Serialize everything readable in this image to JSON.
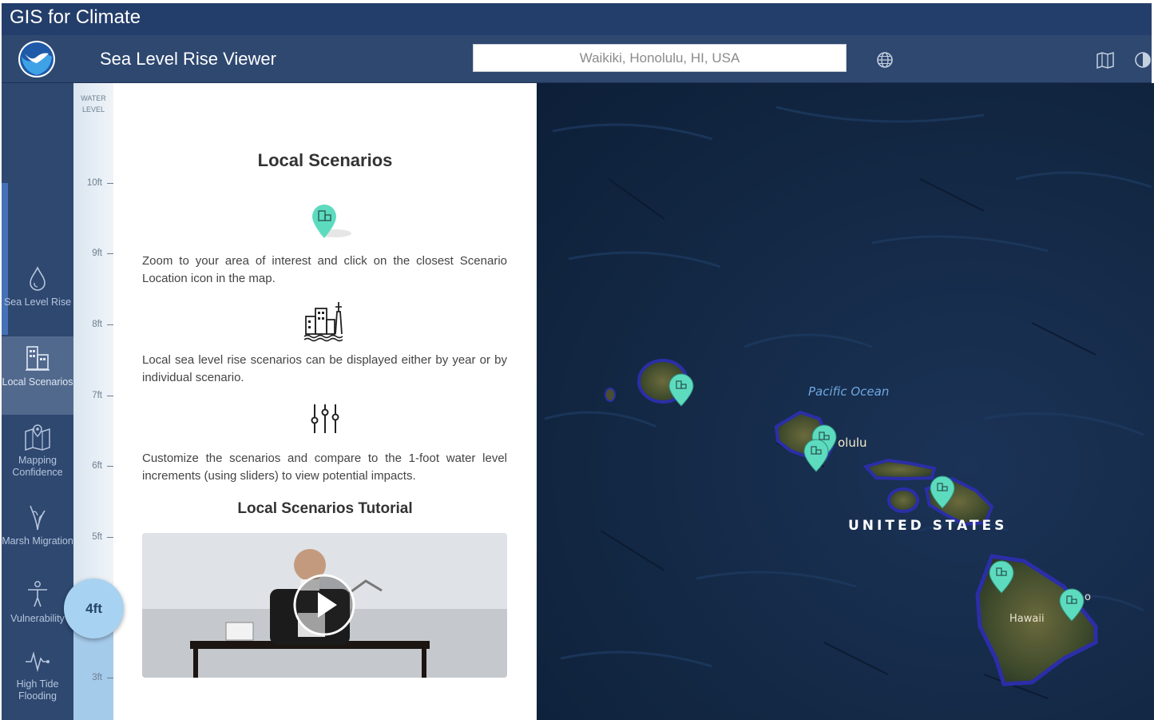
{
  "app": {
    "title": "GIS for Climate"
  },
  "toolbar": {
    "viewer_title": "Sea Level Rise Viewer",
    "search_value": "Waikiki, Honolulu, HI, USA",
    "icons": [
      "noaa-logo",
      "globe-icon",
      "basemap-icon",
      "contrast-icon"
    ]
  },
  "sidebar": {
    "items": [
      {
        "label": "Sea Level Rise",
        "icon": "water-drop-icon"
      },
      {
        "label": "Local Scenarios",
        "icon": "buildings-icon",
        "active": true
      },
      {
        "label": "Mapping Confidence",
        "icon": "map-pin-icon"
      },
      {
        "label": "Marsh Migration",
        "icon": "marsh-icon"
      },
      {
        "label": "Vulnerability",
        "icon": "person-icon"
      },
      {
        "label": "High Tide Flooding",
        "icon": "pulse-icon"
      }
    ]
  },
  "water_level": {
    "caption": "WATER LEVEL",
    "ticks": [
      "10ft",
      "9ft",
      "8ft",
      "7ft",
      "6ft",
      "5ft",
      "3ft"
    ],
    "current": "4ft",
    "current_value_ft": 4
  },
  "panel": {
    "title": "Local Scenarios",
    "para1": "Zoom to your area of interest and click on the closest Scenario Location icon in the map.",
    "para2": "Local sea level rise scenarios can be displayed either by year or by individual scenario.",
    "para3": "Customize the scenarios and compare to the 1-foot water level increments (using sliders) to view potential impacts.",
    "tutorial_title": "Local Scenarios Tutorial"
  },
  "map": {
    "labels": {
      "ocean": "Pacific Ocean",
      "city": "olulu",
      "country": "UNITED STATES",
      "island": "Hawaii",
      "edge": "o"
    },
    "marker_color": "#5ddbbf"
  },
  "colors": {
    "titlebar": "#243e6b",
    "toolbar": "#2e4870",
    "active_nav": "#52698e",
    "water": "#a5cbeb"
  }
}
